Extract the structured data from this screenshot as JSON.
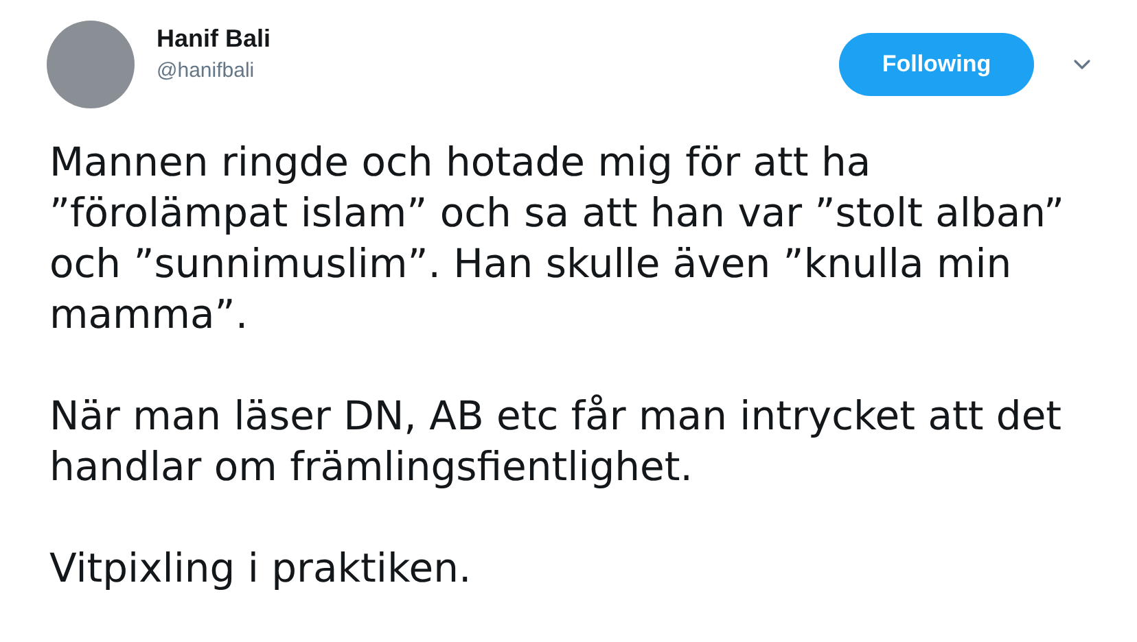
{
  "author": {
    "name": "Hanif Bali",
    "handle": "@hanifbali"
  },
  "follow_button": {
    "label": "Following",
    "following": true
  },
  "paragraphs": [
    "Mannen ringde och hotade mig för att ha ”förolämpat islam” och sa att han var ”stolt alban” och ”sunnimuslim”. Han skulle även ”knulla min mamma”.",
    "När man läser DN, AB etc får man intrycket att det handlar om främlingsfientlighet.",
    "Vitpixling i praktiken."
  ]
}
